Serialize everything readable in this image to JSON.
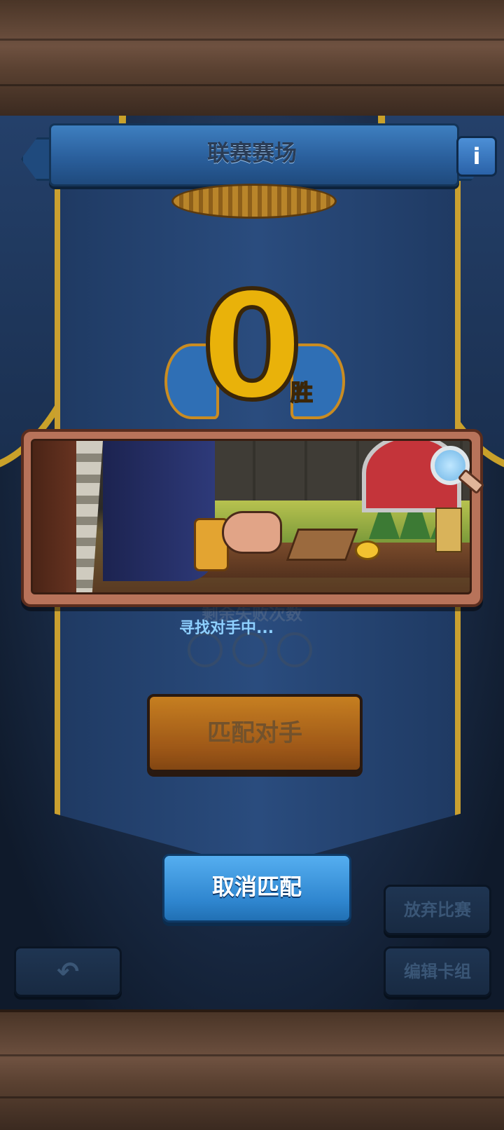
{
  "header": {
    "title": "联赛赛场"
  },
  "info_icon": "i",
  "wins": {
    "count": "0",
    "suffix": "胜"
  },
  "matching": {
    "faded_label": "剩余失败次数",
    "status": "寻找对手中..."
  },
  "buttons": {
    "match_label": "匹配对手",
    "cancel_label": "取消匹配",
    "forfeit_label": "放弃比赛",
    "edit_deck_label": "编辑卡组",
    "back_icon": "↶"
  },
  "colors": {
    "accent_gold": "#e9b20a",
    "cancel_blue": "#2f86cf",
    "match_orange": "#c0721a",
    "status_text": "#8ed0ff"
  },
  "icons": [
    "info-icon",
    "magnifier-icon",
    "back-arrow-icon"
  ]
}
